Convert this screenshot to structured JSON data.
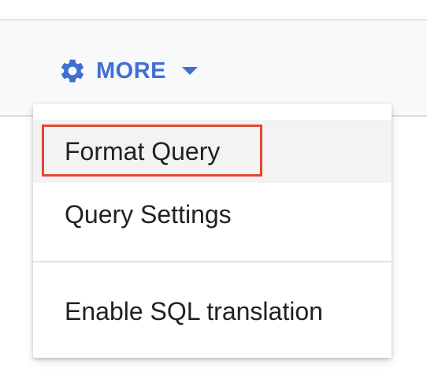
{
  "toolbar": {
    "more_label": "MORE",
    "accent_color": "#3f6fd3",
    "icons": [
      "gear-icon",
      "caret-down-icon"
    ]
  },
  "menu": {
    "items": [
      {
        "label": "Format Query"
      },
      {
        "label": "Query Settings"
      },
      {
        "label": "Enable SQL translation"
      }
    ],
    "highlight_color": "#e04a31"
  }
}
